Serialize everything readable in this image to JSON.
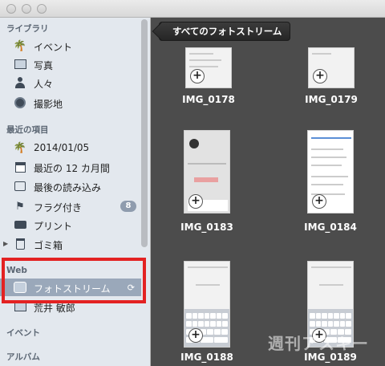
{
  "sidebar": {
    "sections": {
      "library": "ライブラリ",
      "recent": "最近の項目",
      "web": "Web",
      "events": "イベント",
      "albums": "アルバム"
    },
    "library_items": [
      {
        "label": "イベント",
        "icon": "palm-tree-icon"
      },
      {
        "label": "写真",
        "icon": "photo-icon"
      },
      {
        "label": "人々",
        "icon": "person-icon"
      },
      {
        "label": "撮影地",
        "icon": "globe-icon"
      }
    ],
    "recent_items": [
      {
        "label": "2014/01/05",
        "icon": "palm-tree-icon"
      },
      {
        "label": "最近の 12 カ月間",
        "icon": "calendar-icon"
      },
      {
        "label": "最後の読み込み",
        "icon": "import-icon"
      },
      {
        "label": "フラグ付き",
        "icon": "flag-icon",
        "badge": "8"
      },
      {
        "label": "プリント",
        "icon": "printer-icon"
      },
      {
        "label": "ゴミ箱",
        "icon": "trash-icon"
      }
    ],
    "web_items": [
      {
        "label": "フォトストリーム",
        "icon": "photostream-icon",
        "selected": true
      },
      {
        "label": "荒井 敏郎",
        "icon": "shared-stream-icon"
      }
    ],
    "highlight_color": "#e32222"
  },
  "main": {
    "back_button": "すべてのフォトストリーム",
    "photos": [
      {
        "name": "IMG_0178"
      },
      {
        "name": "IMG_0179"
      },
      {
        "name": "IMG_0183"
      },
      {
        "name": "IMG_0184"
      },
      {
        "name": "IMG_0188"
      },
      {
        "name": "IMG_0189"
      }
    ]
  },
  "watermark": "週刊アスキー"
}
